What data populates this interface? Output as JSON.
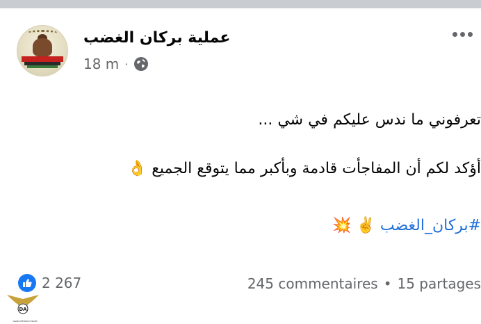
{
  "post": {
    "page_name": "عملية بركان الغضب",
    "time": "18 m",
    "separator": "·",
    "privacy_icon": "globe-icon",
    "menu_icon": "more-options-icon",
    "lines": [
      "تعرفوني ما ندس عليكم في شي ...",
      "أؤكد لكم أن المفاجأت قادمة وبأكبر مما يتوقع الجميع",
      "#بركان_الغضب"
    ],
    "emojis": {
      "ok_hand": "👌",
      "victory": "✌️",
      "collision": "💥"
    }
  },
  "footer": {
    "reaction_icon": "like-icon",
    "reaction_count": "2 267",
    "comments": "245 commentaires",
    "dot": "•",
    "shares": "15 partages"
  },
  "watermark": {
    "logo": "eagle-emblem",
    "text": "ARAB DEFENSE FORUM"
  },
  "colors": {
    "link": "#216fdb",
    "meta": "#65676b",
    "like": "#1877f2",
    "top_strip": "#c9ccd1"
  }
}
